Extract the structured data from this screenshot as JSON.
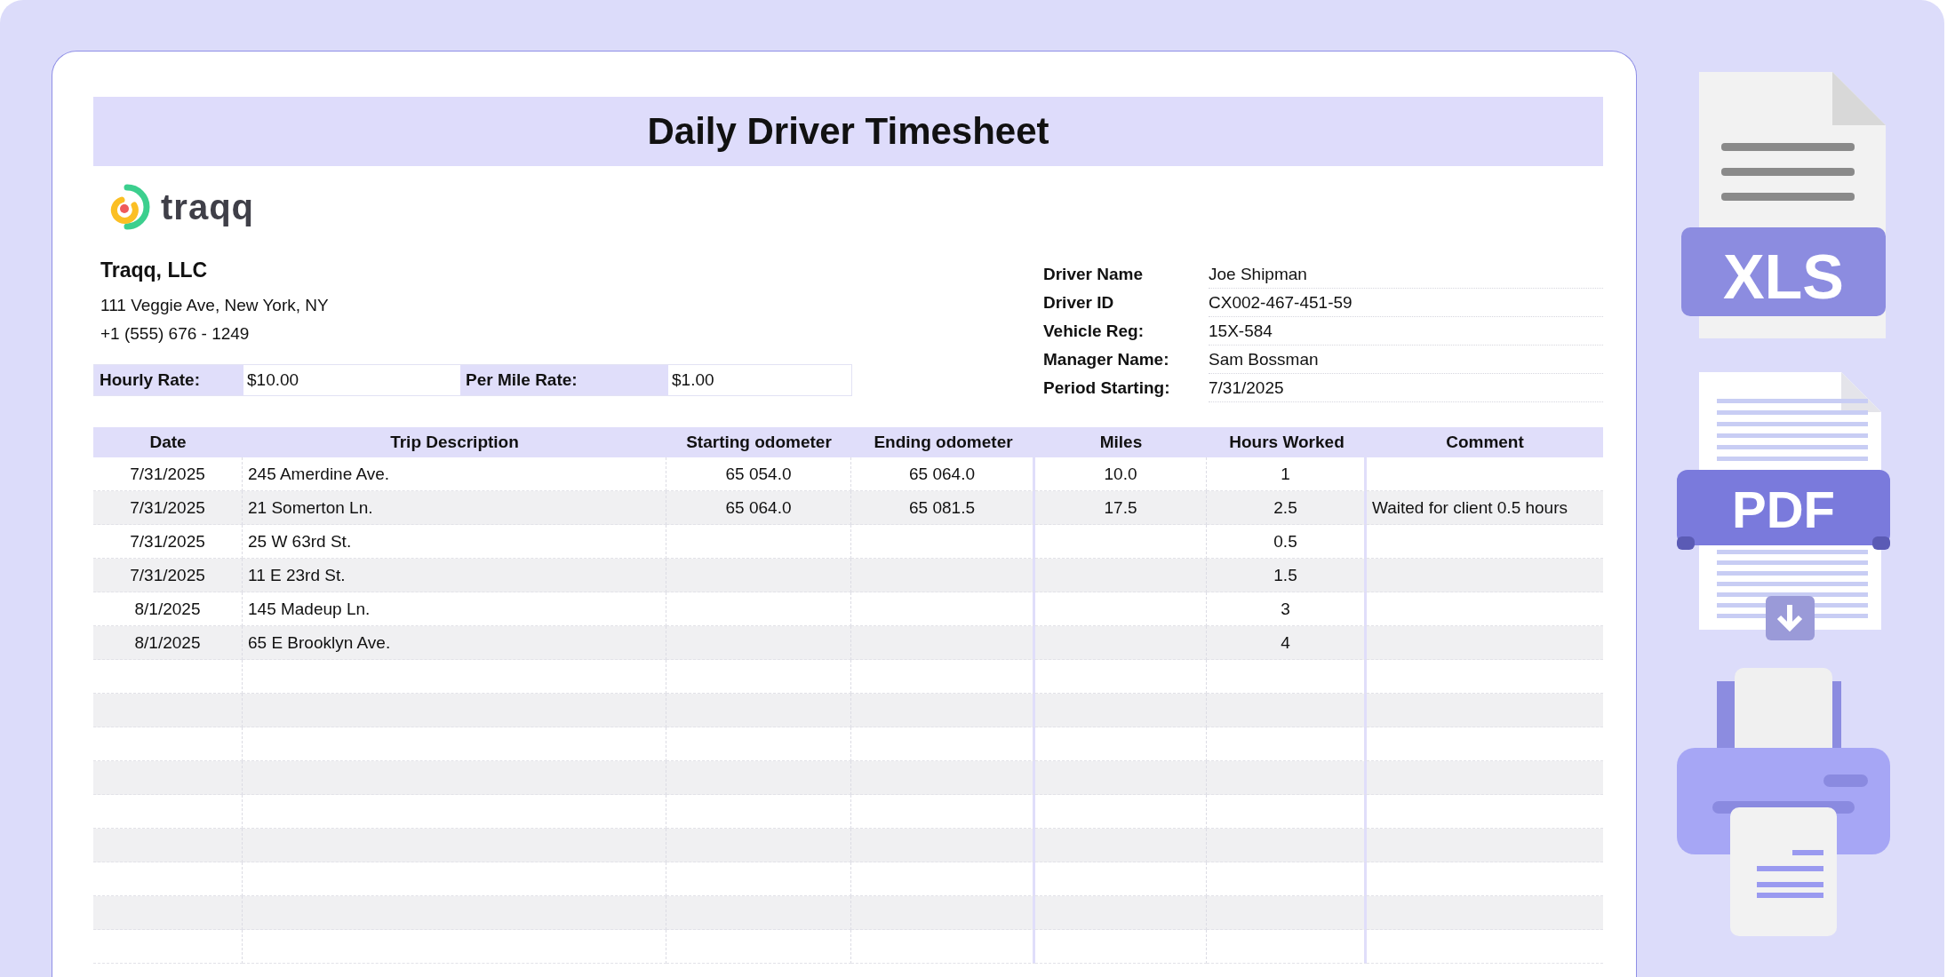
{
  "title": "Daily Driver Timesheet",
  "logo": {
    "text": "traqq"
  },
  "company": {
    "name": "Traqq, LLC",
    "address": "111 Veggie Ave, New York, NY",
    "phone": "+1 (555) 676 - 1249"
  },
  "rates": [
    {
      "label": "Hourly Rate:",
      "value": "$10.00"
    },
    {
      "label": "Per Mile Rate:",
      "value": "$1.00"
    }
  ],
  "driver_info": [
    {
      "label": "Driver Name",
      "value": "Joe Shipman"
    },
    {
      "label": "Driver ID",
      "value": "CX002-467-451-59"
    },
    {
      "label": "Vehicle Reg:",
      "value": "15X-584"
    },
    {
      "label": "Manager Name:",
      "value": "Sam Bossman"
    },
    {
      "label": "Period Starting:",
      "value": "7/31/2025"
    }
  ],
  "table": {
    "columns": [
      "Date",
      "Trip Description",
      "Starting odometer",
      "Ending odometer",
      "Miles",
      "Hours Worked",
      "Comment"
    ],
    "rows": [
      {
        "date": "7/31/2025",
        "trip": "245 Amerdine Ave.",
        "start": "65 054.0",
        "end": "65 064.0",
        "miles": "10.0",
        "hours": "1"
      },
      {
        "date": "7/31/2025",
        "trip": "21 Somerton Ln.",
        "start": "65 064.0",
        "end": "65 081.5",
        "miles": "17.5",
        "hours": "2.5",
        "comment": "Waited for client 0.5 hours"
      },
      {
        "date": "7/31/2025",
        "trip": "25 W 63rd St.",
        "hours": "0.5"
      },
      {
        "date": "7/31/2025",
        "trip": "11 E 23rd St.",
        "hours": "1.5"
      },
      {
        "date": "8/1/2025",
        "trip": "145 Madeup Ln.",
        "hours": "3"
      },
      {
        "date": "8/1/2025",
        "trip": "65 E Brooklyn Ave.",
        "hours": "4"
      }
    ]
  },
  "exports": [
    {
      "kind": "xls",
      "label": "XLS"
    },
    {
      "kind": "pdf",
      "label": "PDF"
    },
    {
      "kind": "print"
    }
  ]
}
